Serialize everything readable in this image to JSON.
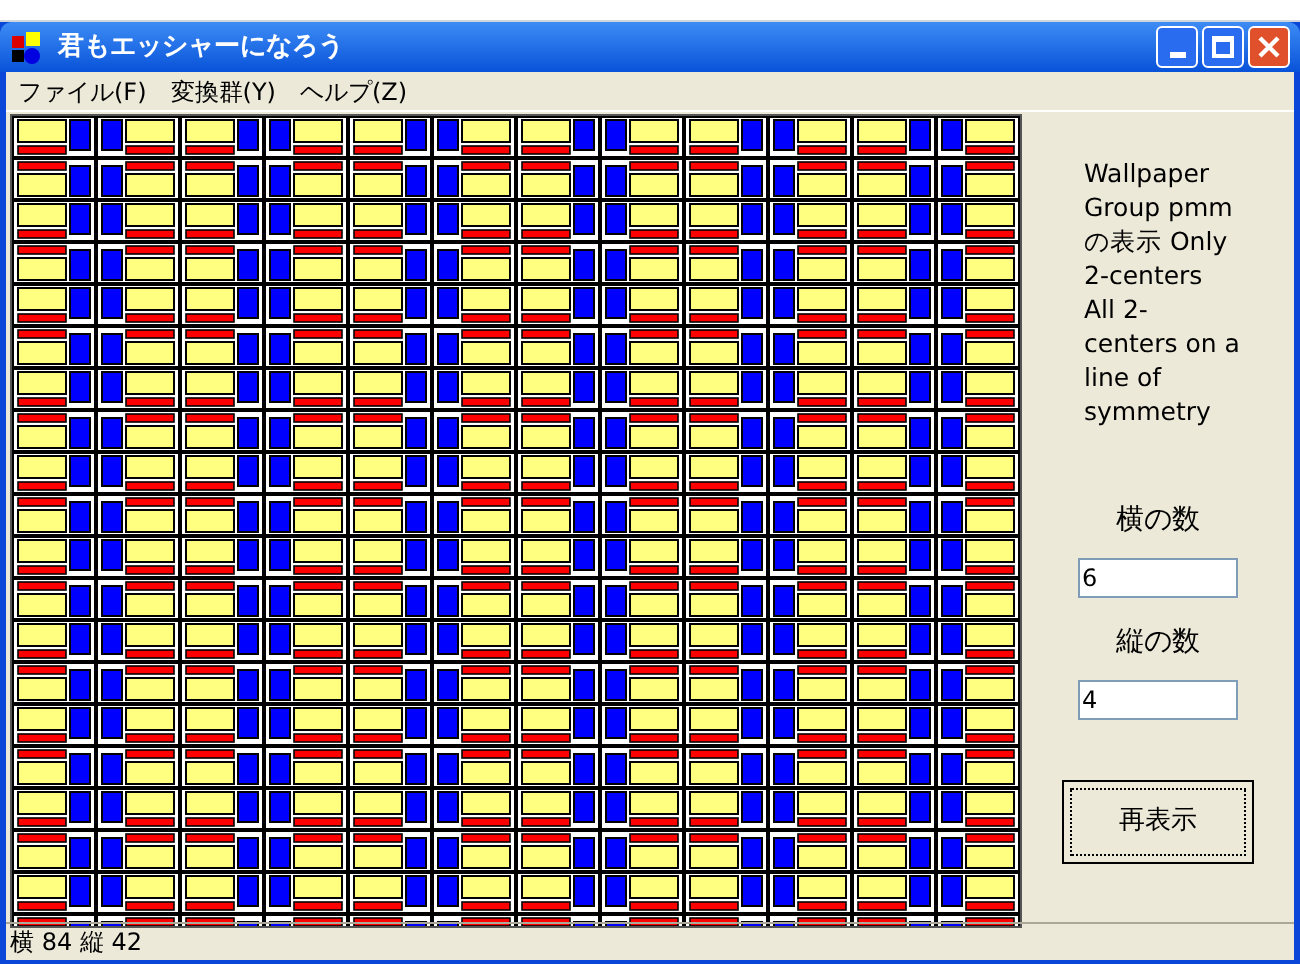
{
  "window": {
    "title": "君もエッシャーになろう"
  },
  "menu": [
    "ファイル(F)",
    "変換群(Y)",
    "ヘルプ(Z)"
  ],
  "panel": {
    "description": "Wallpaper Group pmm の表示 Only 2-centers All 2-centers on a line of symmetry",
    "fields": [
      {
        "label": "横の数",
        "value": "6"
      },
      {
        "label": "縦の数",
        "value": "4"
      }
    ],
    "button": "再表示"
  },
  "status_bar": "横 84 縦 42"
}
